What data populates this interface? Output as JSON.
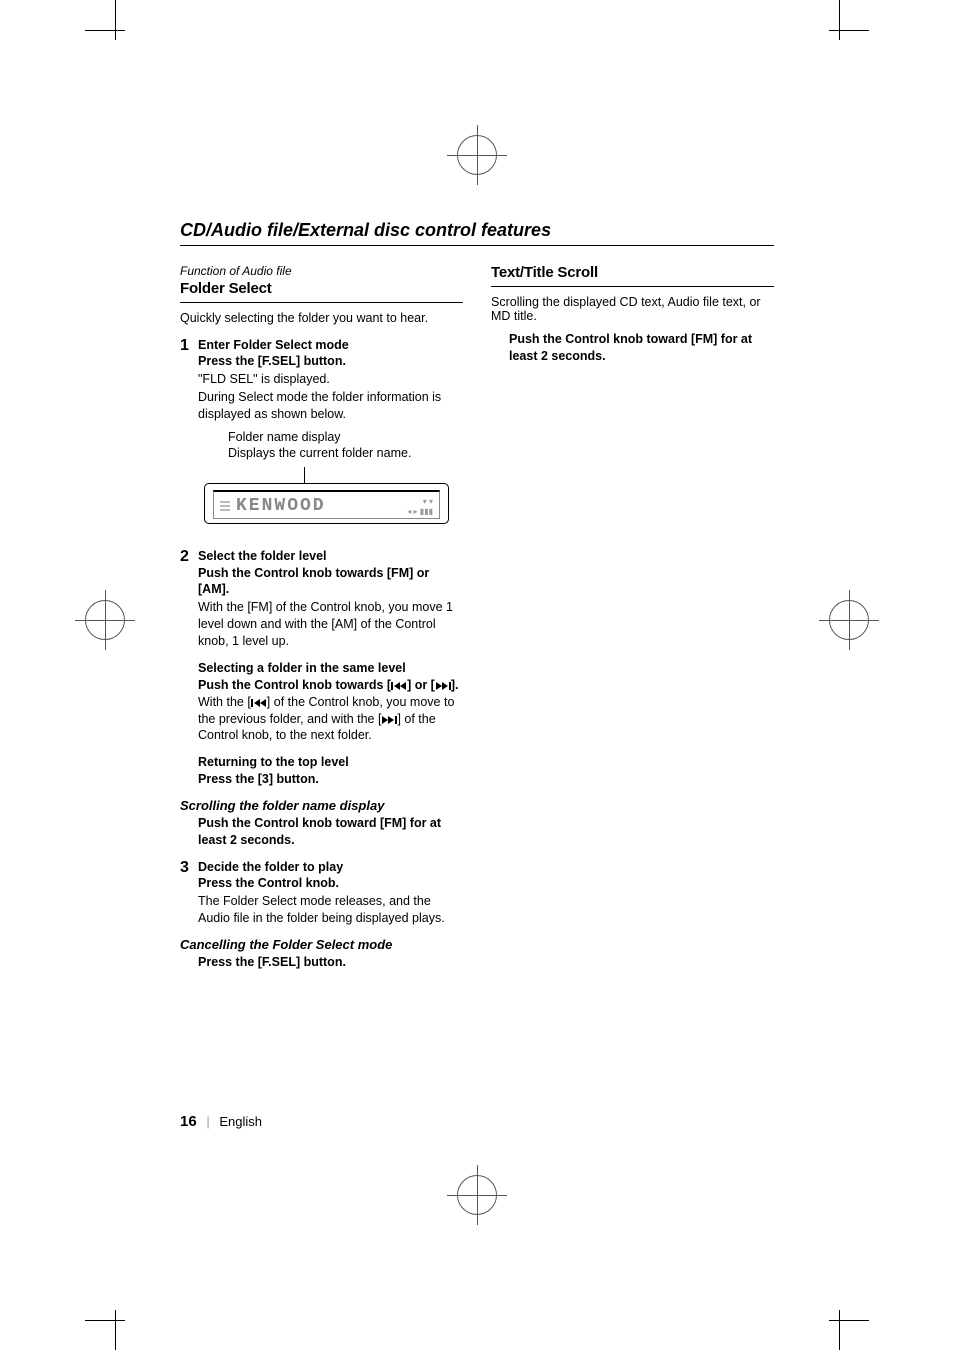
{
  "page": {
    "title": "CD/Audio file/External disc control features",
    "number": "16",
    "language": "English"
  },
  "left": {
    "func_label": "Function of Audio file",
    "heading": "Folder Select",
    "intro": "Quickly selecting the folder you want to hear.",
    "step1": {
      "num": "1",
      "title": "Enter Folder Select mode",
      "instr": "Press the [F.SEL] button.",
      "desc1": "\"FLD SEL\" is displayed.",
      "desc2": "During Select mode the folder information is displayed as shown below.",
      "caption1": "Folder name display",
      "caption2": "Displays the current folder name.",
      "lcd_text": "KENWOOD"
    },
    "step2": {
      "num": "2",
      "title": "Select the folder level",
      "instr": "Push the Control knob towards [FM] or [AM].",
      "desc": "With the [FM] of the Control knob, you move 1 level down and with the [AM] of the Control knob, 1 level up."
    },
    "sub_same": {
      "title": "Selecting a folder in the same level",
      "instr_a": "Push the Control knob towards [",
      "instr_b": "] or [",
      "instr_c": "].",
      "desc_a": "With the [",
      "desc_b": "] of the Control knob, you move to the previous folder, and with the [",
      "desc_c": "] of the Control knob, to the next folder."
    },
    "sub_top": {
      "title": "Returning to the top level",
      "instr": "Press the [3] button."
    },
    "scroll": {
      "title": "Scrolling the folder name display",
      "instr": "Push the Control knob toward [FM] for at least 2 seconds."
    },
    "step3": {
      "num": "3",
      "title": "Decide the folder to play",
      "instr": "Press the Control knob.",
      "desc": "The Folder Select mode releases, and the Audio file in the folder being displayed plays."
    },
    "cancel": {
      "title": "Cancelling the Folder Select mode",
      "instr": "Press the [F.SEL] button."
    }
  },
  "right": {
    "heading": "Text/Title Scroll",
    "intro": "Scrolling the displayed CD text, Audio file text, or MD title.",
    "instr": "Push the Control knob toward [FM] for at least 2 seconds."
  }
}
